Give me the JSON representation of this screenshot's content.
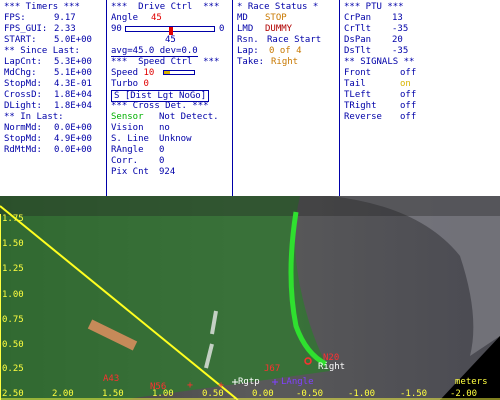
{
  "timers": {
    "header": "*** Timers ***",
    "fps_label": "FPS:",
    "fps_value": "9.17",
    "fps_gui_label": "FPS_GUI:",
    "fps_gui_value": "2.33",
    "start_label": "START:",
    "start_value": "5.0E+00",
    "since_header": "** Since Last:",
    "since": [
      {
        "label": "LapCnt:",
        "value": "5.3E+00"
      },
      {
        "label": "MdChg:",
        "value": "5.1E+00"
      },
      {
        "label": "StopMd:",
        "value": "4.3E-01"
      },
      {
        "label": "CrossD:",
        "value": "1.8E+04"
      },
      {
        "label": "DLight:",
        "value": "1.8E+04"
      }
    ],
    "inlast_header": "** In Last:",
    "inlast": [
      {
        "label": "NormMd:",
        "value": "0.0E+00"
      },
      {
        "label": "StopMd:",
        "value": "4.9E+00"
      },
      {
        "label": "RdMtMd:",
        "value": "0.0E+00"
      }
    ]
  },
  "drive": {
    "header": "***  Drive Ctrl  ***",
    "angle_label": "Angle",
    "angle_value": "45",
    "slider_left": "90",
    "slider_right": "0",
    "slider_value": "45",
    "slider_fraction": 0.5,
    "avg_text": "avg=45.0  dev=0.0",
    "speed_header": "***  Speed Ctrl  ***",
    "speed_label": "Speed",
    "speed_value": "10",
    "speed_fraction": 0.2,
    "turbo_label": "Turbo",
    "turbo_value": "0",
    "dist_text": "S [Dist Lgt NoGo]",
    "cross_header": "*** Cross Det. ***",
    "sensor_label": "Sensor",
    "sensor_value": "Not Detect.",
    "rows": [
      {
        "label": "Vision",
        "value": "no"
      },
      {
        "label": "S. Line",
        "value": "Unknow"
      },
      {
        "label": "RAngle",
        "value": "0"
      },
      {
        "label": "Corr.",
        "value": "0"
      },
      {
        "label": "Pix Cnt",
        "value": "924"
      }
    ]
  },
  "race": {
    "header": "* Race Status *",
    "md_label": "MD",
    "md_value": "STOP",
    "lmd_label": "LMD",
    "lmd_value": "DUMMY",
    "rsn_label": "Rsn.",
    "rsn_value": "Race Start",
    "lap_label": "Lap:",
    "lap_value": "0 of 4",
    "take_label": "Take:",
    "take_value": "Right"
  },
  "ptu": {
    "header": "*** PTU ***",
    "rows": [
      {
        "label": "CrPan",
        "value": "13"
      },
      {
        "label": "CrTlt",
        "value": "-35"
      },
      {
        "label": "DsPan",
        "value": "20"
      },
      {
        "label": "DsTlt",
        "value": "-35"
      }
    ],
    "signals_header": "** SIGNALS **",
    "signals": [
      {
        "label": "Front",
        "value": "off",
        "color": "#0000a8"
      },
      {
        "label": "Tail",
        "value": "on",
        "color": "#d8b400"
      },
      {
        "label": "TLeft",
        "value": "off",
        "color": "#0000a8"
      },
      {
        "label": "TRight",
        "value": "off",
        "color": "#0000a8"
      },
      {
        "label": "Reverse",
        "value": "off",
        "color": "#0000a8"
      }
    ]
  },
  "view": {
    "y_ticks": [
      "1.75",
      "1.50",
      "1.25",
      "1.00",
      "0.75",
      "0.50",
      "0.25"
    ],
    "x_ticks": [
      "2.50",
      "2.00",
      "1.50",
      "1.00",
      "0.50",
      "0.00",
      "-0.50",
      "-1.00",
      "-1.50",
      "-2.00"
    ],
    "x_unit": "meters",
    "markers": {
      "right": "Right",
      "rgtp": "Rgtp",
      "langle": "LAngle",
      "j67": "J67",
      "a43": "A43",
      "n56": "N56",
      "n20": "N20"
    },
    "colors": {
      "axis": "#ffff40",
      "track_green": "#2fe02f",
      "overlay_green": "#2f7a2f",
      "marker_red": "#ff3030",
      "marker_purple": "#8040ff",
      "marker_white": "#ffffff"
    }
  }
}
